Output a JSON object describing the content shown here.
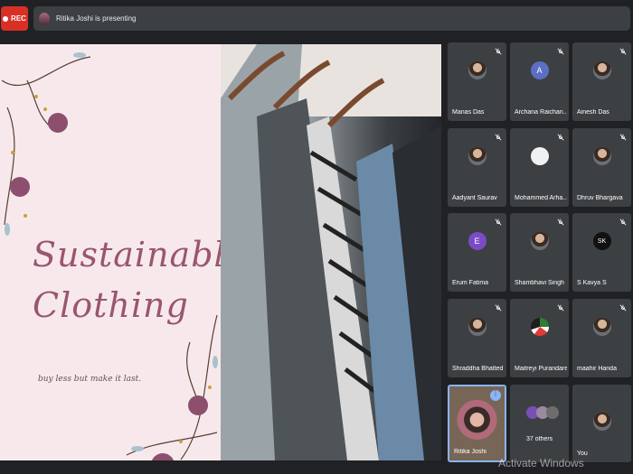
{
  "toolbar": {
    "rec_label": "REC",
    "presenting_text": "Ritika Joshi is presenting"
  },
  "slide": {
    "title_line1": "Sustainable",
    "title_line2": "Clothing",
    "tagline": "buy less but make it last."
  },
  "participants": [
    {
      "name": "Manas Das",
      "avatar": "photo"
    },
    {
      "name": "Archana Raichan...",
      "avatar": "letter",
      "letter": "A"
    },
    {
      "name": "Ainesh Das",
      "avatar": "photo"
    },
    {
      "name": "Aadyant Saurav",
      "avatar": "photo"
    },
    {
      "name": "Mohammed Arha...",
      "avatar": "logo"
    },
    {
      "name": "Dhruv Bhargava",
      "avatar": "photo"
    },
    {
      "name": "Erum Fatima",
      "avatar": "letter",
      "letter": "E"
    },
    {
      "name": "Shambhavi Singh",
      "avatar": "photo"
    },
    {
      "name": "S Kavya S",
      "avatar": "sk",
      "letter": "SK"
    },
    {
      "name": "Shraddha Bhatted",
      "avatar": "photo"
    },
    {
      "name": "Maitreyi Purandare",
      "avatar": "logo"
    },
    {
      "name": "maahir Handa",
      "avatar": "photo"
    }
  ],
  "bottom_tiles": {
    "presenter": "Ritika Joshi",
    "others": "37 others",
    "you": "You"
  },
  "watermark": "Activate Windows",
  "colors": {
    "rec": "#d93025",
    "tile": "#3c4043",
    "background": "#202124",
    "accent": "#8ab4f8"
  }
}
